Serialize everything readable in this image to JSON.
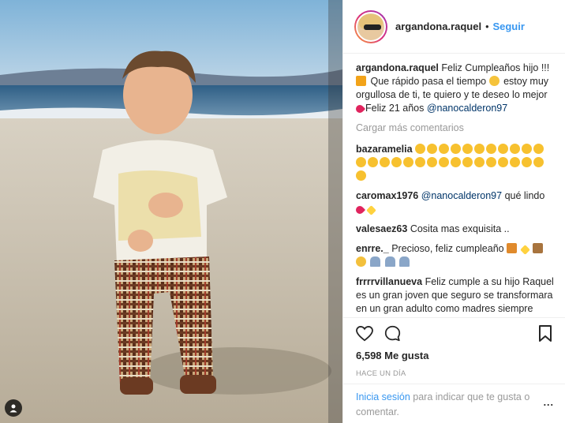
{
  "post": {
    "username": "argandona.raquel",
    "follow_label": "Seguir",
    "header_dot": "•"
  },
  "caption": {
    "username": "argandona.raquel",
    "text_part1": "Feliz Cumpleaños hijo !!!",
    "text_part2": "Que rápido pasa el tiempo",
    "text_part3": "estoy muy orgullosa de ti, te quiero y te deseo lo mejor",
    "text_part4": "Feliz 21 años",
    "mention": "@nanocalderon97"
  },
  "load_more_label": "Cargar más comentarios",
  "comments": [
    {
      "username": "bazaramelia",
      "clap_count": 28
    },
    {
      "username": "caromax1976",
      "mention": "@nanocalderon97",
      "text": "qué lindo"
    },
    {
      "username": "valesaez63",
      "text": "Cosita mas exquisita .."
    },
    {
      "username": "enrre._",
      "text": "Precioso, feliz cumpleaño"
    },
    {
      "username": "frrrrvillanueva",
      "text": "Feliz cumple a su hijo Raquel es un gran joven que seguro se transformara en un gran adulto como madres siempre vemos a nuestros hijos pequeños ws una sensación rara esa de"
    }
  ],
  "icons": {
    "like": "heart-outline-icon",
    "comment": "comment-bubble-icon",
    "bookmark": "bookmark-icon",
    "tag": "person-tag-icon"
  },
  "likes_label": "6,598 Me gusta",
  "time_label": "HACE UN DÍA",
  "footer": {
    "login_label": "Inicia sesión",
    "rest_label": "para indicar que te gusta o comentar.",
    "more_label": "..."
  },
  "colors": {
    "link_blue": "#3897f0",
    "mention_blue": "#003569",
    "muted": "#999999"
  }
}
